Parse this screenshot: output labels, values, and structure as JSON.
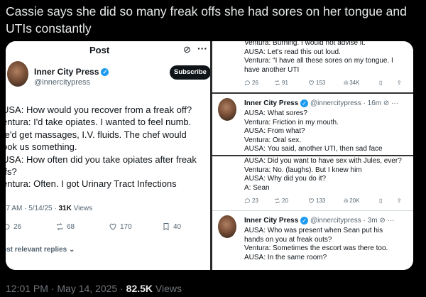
{
  "headline": "Cassie says she did so many freak offs she had sores on her tongue and UTIs constantly",
  "left_post": {
    "title": "Post",
    "author": "Inner City Press",
    "handle": "@innercitypress",
    "subscribe_label": "Subscribe",
    "lines": [
      "USA: How would you recover from a freak off?",
      "entura: I'd take opiates. I wanted to feel numb.",
      "/e'd get massages, I.V. fluids. The chef would",
      "ook us something.",
      "USA: How often did you take opiates after freak",
      "ffs?",
      "entura: Often. I got Urinary Tract Infections"
    ],
    "time_date": "37 AM · 5/14/25 ·",
    "views_count": "31K",
    "views_label": "Views",
    "replies": "26",
    "reposts": "68",
    "likes": "170",
    "bookmarks": "40",
    "most_relevant": "ost relevant replies"
  },
  "right_panel": {
    "top": {
      "lines": [
        "Ventura: Burning. I would not advise it.",
        "AUSA: Let's read this out loud.",
        "Ventura: \"I have all these sores on my tongue. I",
        "have another UTI"
      ],
      "replies": "26",
      "reposts": "91",
      "likes": "153",
      "views": "34K"
    },
    "mid": {
      "author": "Inner City Press",
      "handle_time": "@innercitypress · 16m",
      "lines": [
        "AUSA: What sores?",
        "Ventura: Friction in my mouth.",
        "AUSA: From what?",
        "Ventura: Oral sex.",
        "AUSA: You said, another UTI, then sad face"
      ]
    },
    "mid2": {
      "lines": [
        "AUSA: Did you want to have sex with Jules, ever?",
        "Ventura: No. (laughs). But I knew him",
        "AUSA: Why did you do it?",
        "A: Sean"
      ],
      "replies": "23",
      "reposts": "20",
      "likes": "133",
      "views": "20K"
    },
    "bottom": {
      "author": "Inner City Press",
      "handle_time": "@innercitypress · 3m",
      "lines": [
        "AUSA: Who was present when Sean put his",
        "hands on you at freak outs?",
        "Ventura: Sometimes the escort was there too.",
        "AUSA: In the same room?"
      ]
    }
  },
  "footer": {
    "time_date": "12:01 PM · May 14, 2025 ·",
    "views_count": "82.5K",
    "views_label": "Views"
  }
}
